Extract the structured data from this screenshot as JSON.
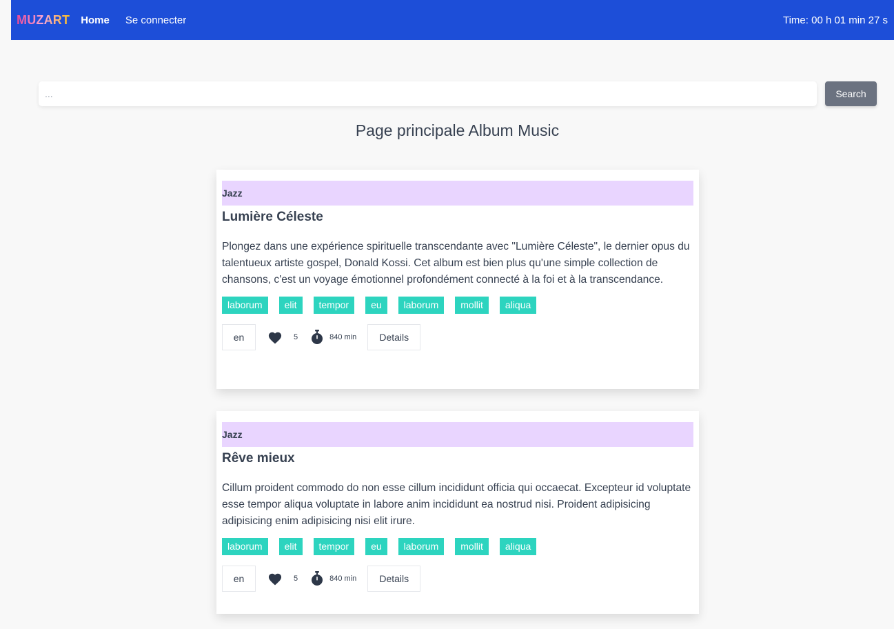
{
  "nav": {
    "brand": "MUZART",
    "home": "Home",
    "login": "Se connecter",
    "timer": "Time: 00 h 01 min 27 s"
  },
  "search": {
    "placeholder": "...",
    "button": "Search"
  },
  "page_title": "Page principale Album Music",
  "albums": [
    {
      "genre": "Jazz",
      "title": "Lumière Céleste",
      "description": "Plongez dans une expérience spirituelle transcendante avec \"Lumière Céleste\", le dernier opus du talentueux artiste gospel, Donald Kossi. Cet album est bien plus qu'une simple collection de chansons, c'est un voyage émotionnel profondément connecté à la foi et à la transcendance.",
      "tags": [
        "laborum",
        "elit",
        "tempor",
        "eu",
        "laborum",
        "mollit",
        "aliqua"
      ],
      "language": "en",
      "likes": "5",
      "duration": "840 min",
      "details_label": "Details"
    },
    {
      "genre": "Jazz",
      "title": "Rêve mieux",
      "description": "Cillum proident commodo do non esse cillum incididunt officia qui occaecat. Excepteur id voluptate esse tempor aliqua voluptate in labore anim incididunt ea nostrud nisi. Proident adipisicing adipisicing enim adipisicing nisi elit irure.",
      "tags": [
        "laborum",
        "elit",
        "tempor",
        "eu",
        "laborum",
        "mollit",
        "aliqua"
      ],
      "language": "en",
      "likes": "5",
      "duration": "840 min",
      "details_label": "Details"
    }
  ],
  "icons": {
    "like": "heart-icon",
    "duration": "stopwatch-icon"
  },
  "colors": {
    "navbar": "#1d4ed8",
    "genre_band": "#e9d5ff",
    "tag": "#2dd4bf",
    "search_button": "#6b7280"
  }
}
